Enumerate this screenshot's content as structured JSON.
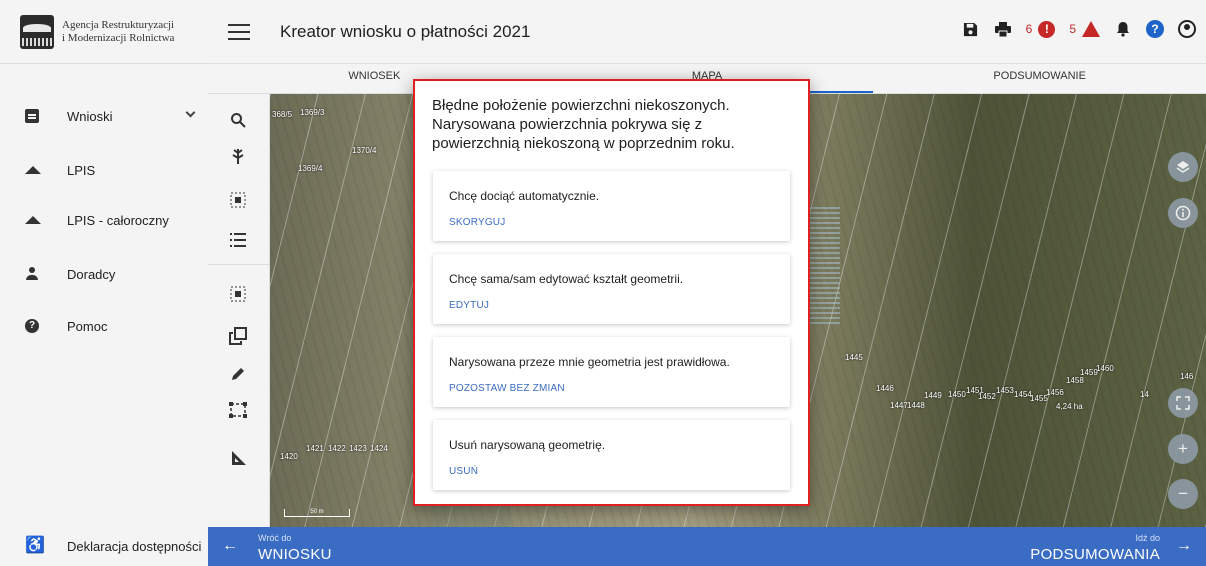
{
  "logo": {
    "line1": "Agencja Restrukturyzacji",
    "line2": "i Modernizacji Rolnictwa"
  },
  "header": {
    "title": "Kreator wniosku o płatności 2021",
    "error_count": "6",
    "warning_count": "5",
    "error_mark": "!",
    "help_mark": "?"
  },
  "tabs": [
    {
      "label": "WNIOSEK"
    },
    {
      "label": "MAPA"
    },
    {
      "label": "PODSUMOWANIE"
    }
  ],
  "sidebar": {
    "items": [
      {
        "label": "Wnioski"
      },
      {
        "label": "LPIS"
      },
      {
        "label": "LPIS - całoroczny"
      },
      {
        "label": "Doradcy"
      },
      {
        "label": "Pomoc"
      }
    ],
    "help_mark": "?",
    "footer": "Deklaracja dostępności"
  },
  "map": {
    "parcels": [
      "368/5",
      "1369/3",
      "1370/4",
      "1369/4",
      "1445",
      "1446",
      "1447",
      "1448",
      "1449",
      "1450",
      "1451",
      "1452",
      "1453",
      "1454",
      "1455",
      "1456",
      "1458",
      "1459",
      "1460",
      "1420",
      "1421",
      "1422",
      "1423",
      "1424",
      "4,24 ha",
      "146",
      "14"
    ],
    "scale": "50 m"
  },
  "bottom": {
    "back_small": "Wróć do",
    "back_big": "WNIOSKU",
    "next_small": "Idź do",
    "next_big": "PODSUMOWANIA"
  },
  "modal": {
    "title": "Błędne położenie powierzchni niekoszonych. Narysowana powierzchnia pokrywa się z powierzchnią niekoszoną w poprzednim roku.",
    "options": [
      {
        "text": "Chcę dociąć automatycznie.",
        "action": "SKORYGUJ"
      },
      {
        "text": "Chcę sama/sam edytować kształt geometrii.",
        "action": "EDYTUJ"
      },
      {
        "text": "Narysowana przeze mnie geometria jest prawidłowa.",
        "action": "POZOSTAW BEZ ZMIAN"
      },
      {
        "text": "Usuń narysowaną geometrię.",
        "action": "USUŃ"
      }
    ]
  },
  "colors": {
    "accent": "#3a6cc4",
    "error": "#c62828",
    "modal_border": "#e02020",
    "panel": "#f4f4f4"
  }
}
